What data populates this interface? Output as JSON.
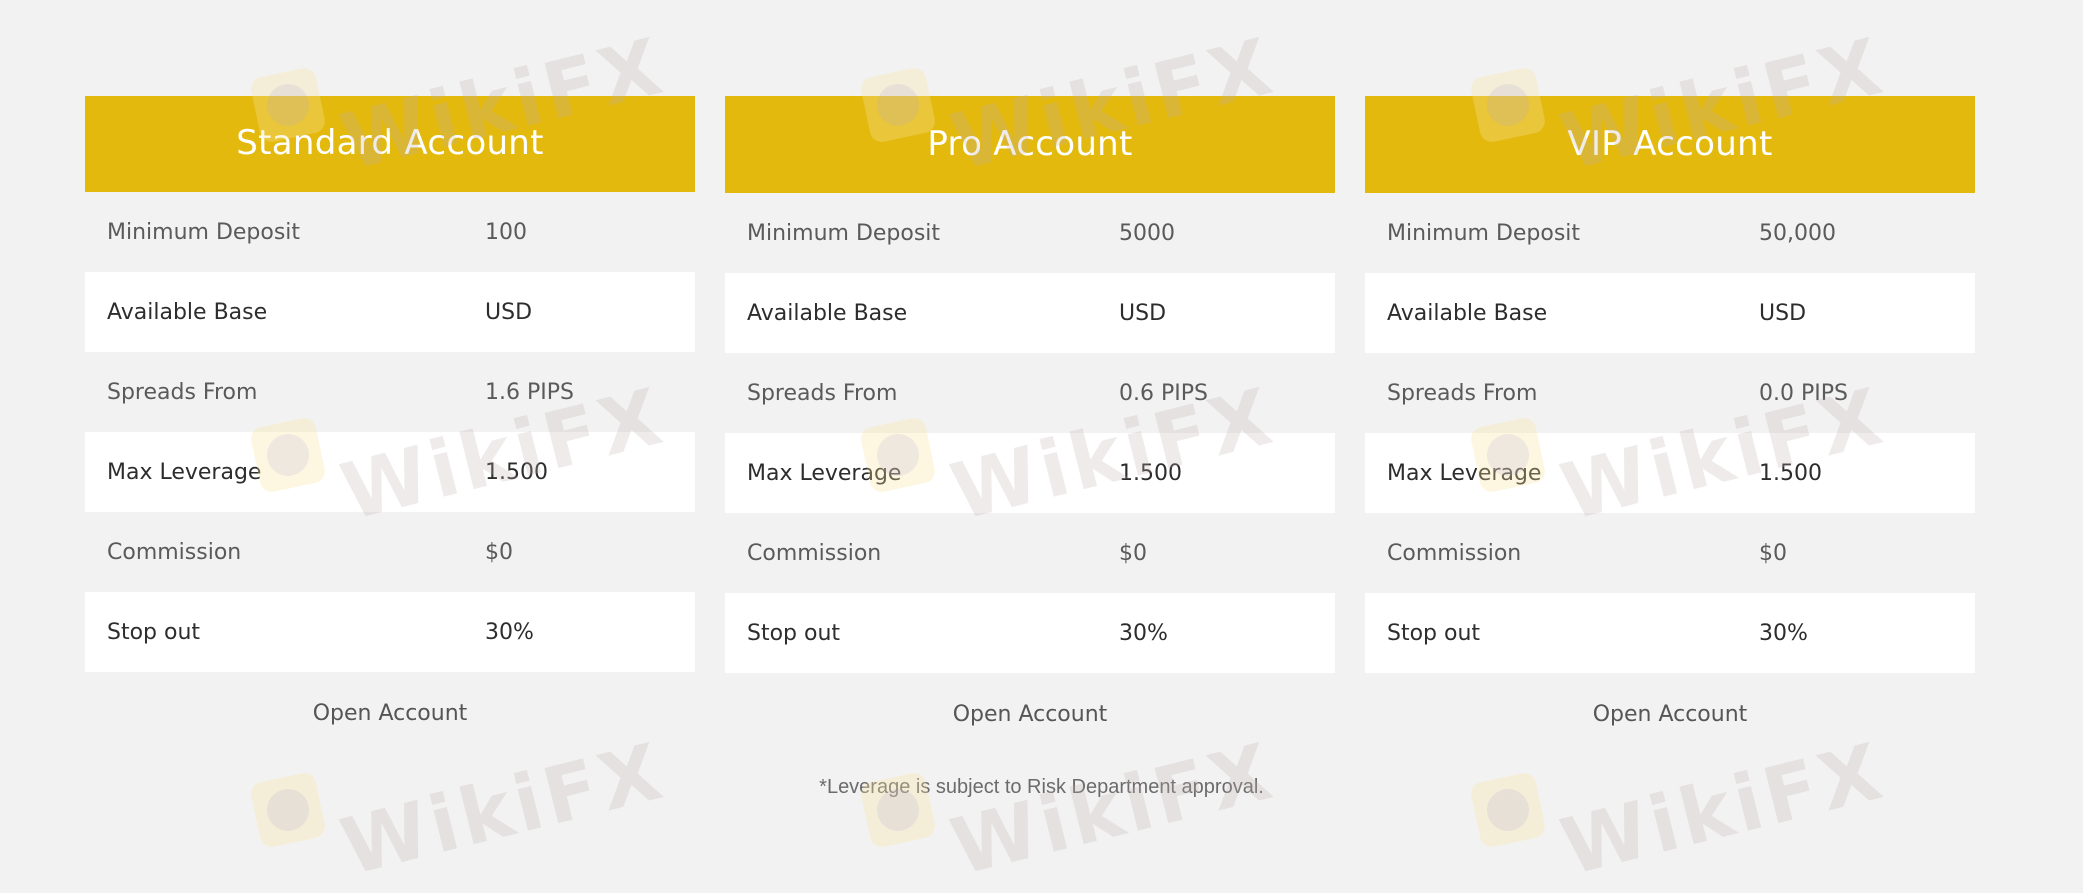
{
  "accounts": [
    {
      "title": "Standard Account",
      "rows": [
        {
          "label": "Minimum Deposit",
          "value": "100"
        },
        {
          "label": "Available Base",
          "value": "USD"
        },
        {
          "label": "Spreads From",
          "value": "1.6 PIPS"
        },
        {
          "label": "Max Leverage",
          "value": "1.500"
        },
        {
          "label": "Commission",
          "value": "$0"
        },
        {
          "label": "Stop out",
          "value": "30%"
        }
      ],
      "cta": "Open Account"
    },
    {
      "title": "Pro Account",
      "rows": [
        {
          "label": "Minimum Deposit",
          "value": "5000"
        },
        {
          "label": "Available Base",
          "value": "USD"
        },
        {
          "label": "Spreads From",
          "value": "0.6 PIPS"
        },
        {
          "label": "Max Leverage",
          "value": "1.500"
        },
        {
          "label": "Commission",
          "value": "$0"
        },
        {
          "label": "Stop out",
          "value": "30%"
        }
      ],
      "cta": "Open Account"
    },
    {
      "title": "VIP Account",
      "rows": [
        {
          "label": "Minimum Deposit",
          "value": "50,000"
        },
        {
          "label": "Available Base",
          "value": "USD"
        },
        {
          "label": "Spreads From",
          "value": "0.0 PIPS"
        },
        {
          "label": "Max Leverage",
          "value": "1.500"
        },
        {
          "label": "Commission",
          "value": "$0"
        },
        {
          "label": "Stop out",
          "value": "30%"
        }
      ],
      "cta": "Open Account"
    }
  ],
  "footnote": "*Leverage is subject to Risk Department approval.",
  "watermark": "WikiFX",
  "colors": {
    "header_bg": "#e3b90e",
    "page_bg": "#f2f2f2",
    "alt_row_bg": "#ffffff"
  }
}
